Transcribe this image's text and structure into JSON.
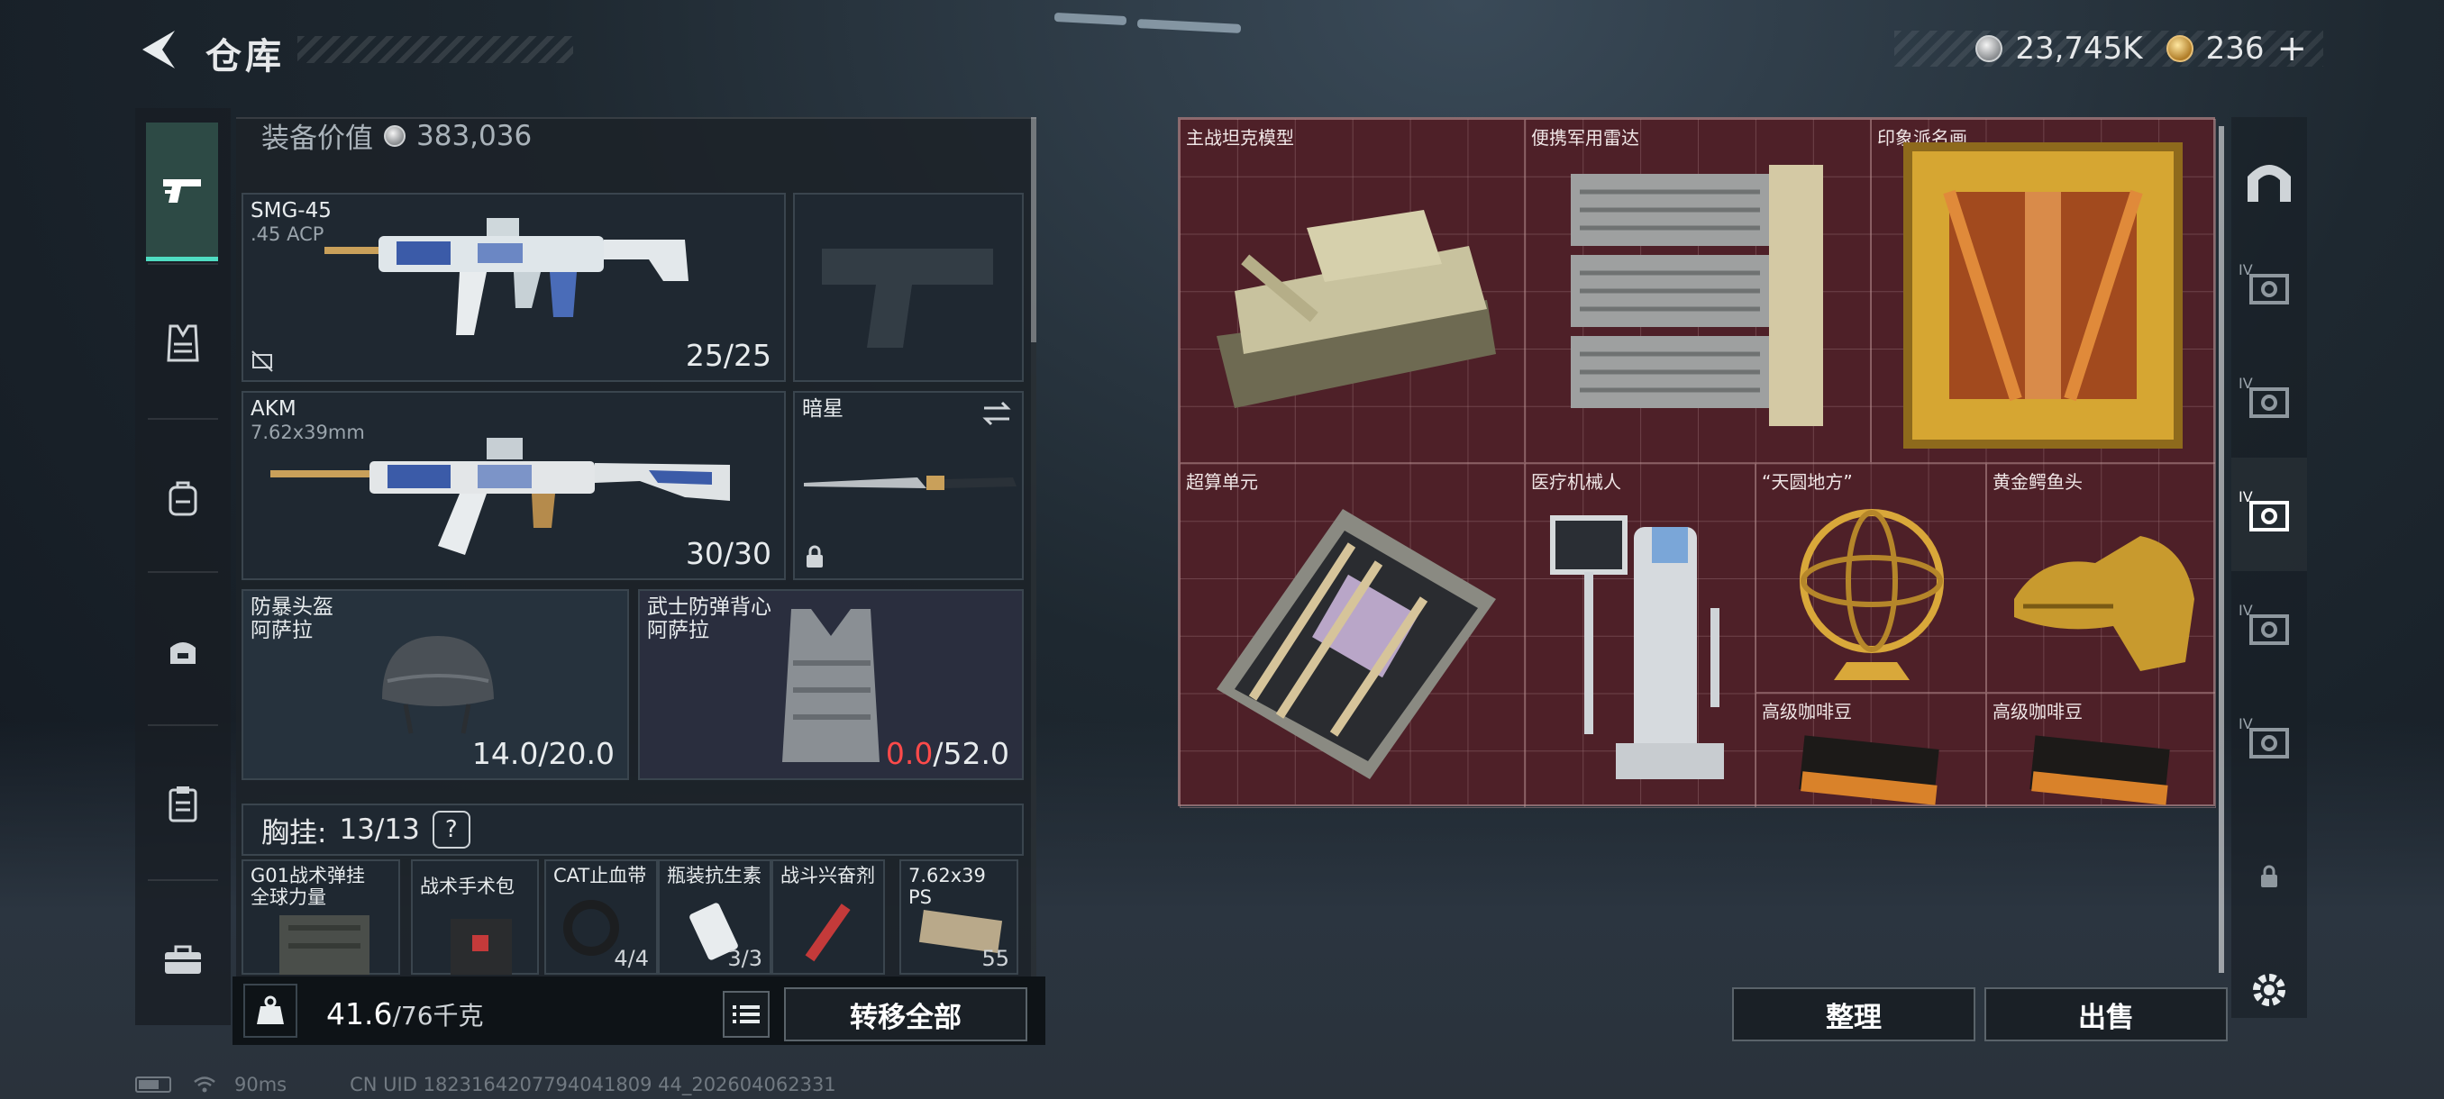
{
  "header": {
    "title": "仓库",
    "currency": [
      {
        "icon": "silver-coin-icon",
        "value": "23,745K"
      },
      {
        "icon": "gold-coin-icon",
        "value": "236"
      }
    ],
    "add_label": "+"
  },
  "left_nav": {
    "items": [
      {
        "icon": "pistol-icon",
        "active": true
      },
      {
        "icon": "vest-icon",
        "active": false
      },
      {
        "icon": "backpack-icon",
        "active": false
      },
      {
        "icon": "bag-icon",
        "active": false
      },
      {
        "icon": "clipboard-icon",
        "active": false
      },
      {
        "icon": "toolbox-icon",
        "active": false
      }
    ]
  },
  "equipment": {
    "value_label": "装备价值",
    "value": "383,036",
    "primary": {
      "name": "SMG-45",
      "ammo": ".45 ACP",
      "count": "25/25"
    },
    "secondary": {
      "name": "AKM",
      "ammo": "7.62x39mm",
      "count": "30/30"
    },
    "melee": {
      "name": "暗星"
    },
    "helmet": {
      "name": "防暴头盔",
      "sub": "阿萨拉",
      "durability": "14.0/20.0"
    },
    "armor": {
      "name": "武士防弹背心",
      "sub": "阿萨拉",
      "durability_current": "0.0",
      "durability_max": "/52.0"
    },
    "rig": {
      "label": "胸挂:",
      "count": "13/13",
      "help": "?"
    },
    "rig_items": [
      {
        "name": "G01战术弹挂",
        "sub": "全球力量"
      },
      {
        "name": "战术手术包"
      },
      {
        "name": "CAT止血带",
        "qty": "4/4"
      },
      {
        "name": "瓶装抗生素",
        "qty": "3/3"
      },
      {
        "name": "战斗兴奋剂"
      },
      {
        "name": "7.62x39",
        "sub": "PS",
        "qty": "55"
      }
    ]
  },
  "bottom_bar": {
    "weight_current": "41.6",
    "weight_max": "/76千克",
    "transfer_all": "转移全部"
  },
  "warehouse": {
    "items": [
      {
        "name": "主战坦克模型"
      },
      {
        "name": "便携军用雷达"
      },
      {
        "name": "印象派名画"
      },
      {
        "name": "超算单元"
      },
      {
        "name": "医疗机械人"
      },
      {
        "name": "“天圆地方”"
      },
      {
        "name": "黄金鳄鱼头"
      },
      {
        "name": "高级咖啡豆"
      },
      {
        "name": "高级咖啡豆"
      }
    ],
    "sort_label": "整理",
    "sell_label": "出售"
  },
  "right_nav": {
    "items": [
      {
        "icon": "arch-icon"
      },
      {
        "icon": "storage-tier-iv-icon",
        "label": "IV"
      },
      {
        "icon": "storage-tier-iv-icon",
        "label": "IV"
      },
      {
        "icon": "storage-tier-iv-icon",
        "label": "IV",
        "active": true
      },
      {
        "icon": "storage-tier-iv-icon",
        "label": "IV"
      },
      {
        "icon": "storage-tier-iv-icon",
        "label": "IV"
      },
      {
        "icon": "lock-icon"
      },
      {
        "icon": "gear-icon"
      }
    ]
  },
  "status": {
    "ping": "90ms",
    "uid": "CN UID 1823164207794041809 44_202604062331"
  }
}
